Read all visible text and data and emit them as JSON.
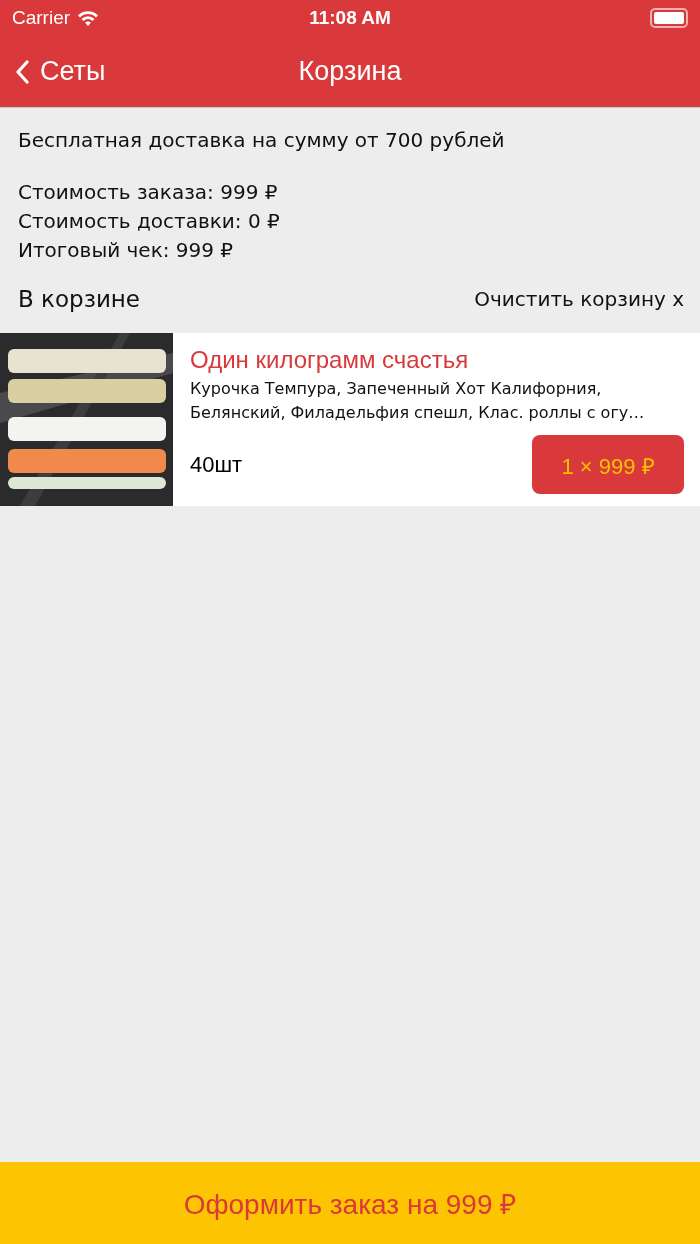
{
  "status_bar": {
    "carrier": "Carrier",
    "time": "11:08 AM"
  },
  "nav": {
    "back": "Сеты",
    "title": "Корзина"
  },
  "info": {
    "free_delivery": "Бесплатная доставка на сумму от 700 рублей",
    "totals": [
      "Стоимость заказа: 999 ₽",
      "Стоимость доставки: 0 ₽",
      "Итоговый чек: 999 ₽"
    ]
  },
  "cart": {
    "heading": "В корзине",
    "clear": "Очистить корзину x"
  },
  "items": [
    {
      "name": "Один килограмм счастья",
      "description": "Курочка Темпура, Запеченный Хот Калифорния, Белянский, Филадельфия спешл, Клас. роллы с огу…",
      "count": "40шт",
      "price_button": "1 × 999 ₽"
    }
  ],
  "checkout_button": "Оформить заказ на 999 ₽"
}
